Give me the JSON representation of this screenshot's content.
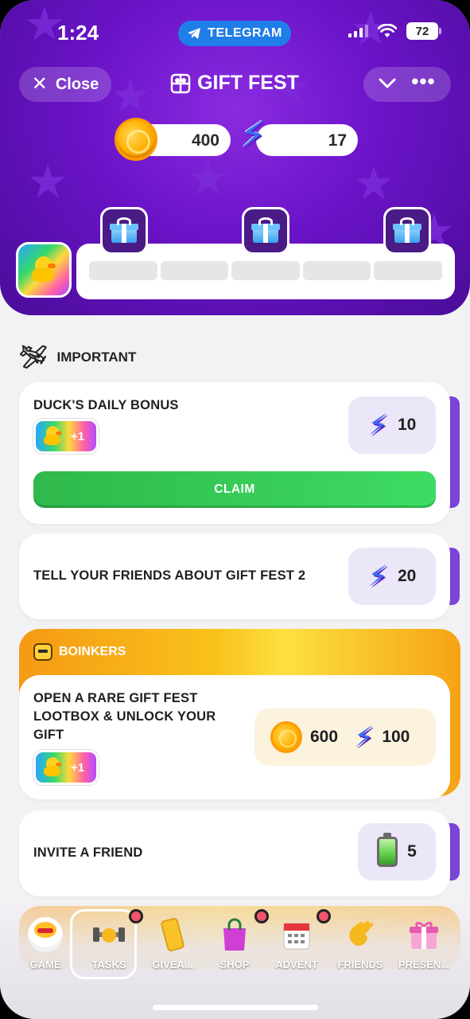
{
  "status_bar": {
    "time": "1:24",
    "telegram_label": "TELEGRAM",
    "battery": "72"
  },
  "header": {
    "close_label": "Close",
    "title": "GIFT FEST"
  },
  "balances": {
    "coins": "400",
    "energy": "17"
  },
  "progress": {
    "segments_total": 5,
    "segments_filled": 0
  },
  "section": {
    "title": "IMPORTANT"
  },
  "tasks": [
    {
      "title": "DUCK'S DAILY BONUS",
      "badge": "+1",
      "reward_energy": "10",
      "button": "CLAIM"
    },
    {
      "title": "TELL YOUR FRIENDS ABOUT GIFT FEST 2",
      "reward_energy": "20"
    }
  ],
  "boinkers": {
    "header": "BOINKERS",
    "task": {
      "title_lines": [
        "OPEN A RARE GIFT FEST",
        "LOOTBOX & UNLOCK YOUR",
        "GIFT"
      ],
      "badge": "+1",
      "reward_coins": "600",
      "reward_energy": "100"
    }
  },
  "invite": {
    "title": "INVITE A FRIEND",
    "reward": "5"
  },
  "bottom_nav": [
    {
      "label": "GAME"
    },
    {
      "label": "TASKS",
      "active": true,
      "notification": true
    },
    {
      "label": "GIVEA..."
    },
    {
      "label": "SHOP",
      "notification": true
    },
    {
      "label": "ADVENT",
      "notification": true
    },
    {
      "label": "FRIENDS"
    },
    {
      "label": "PRESEN..."
    }
  ],
  "colors": {
    "header": "#6a13c7",
    "accent": "#7b44d8",
    "claim": "#3edc62",
    "boinkers": "#f9c21b",
    "tg_blue": "#1f7ee8"
  }
}
